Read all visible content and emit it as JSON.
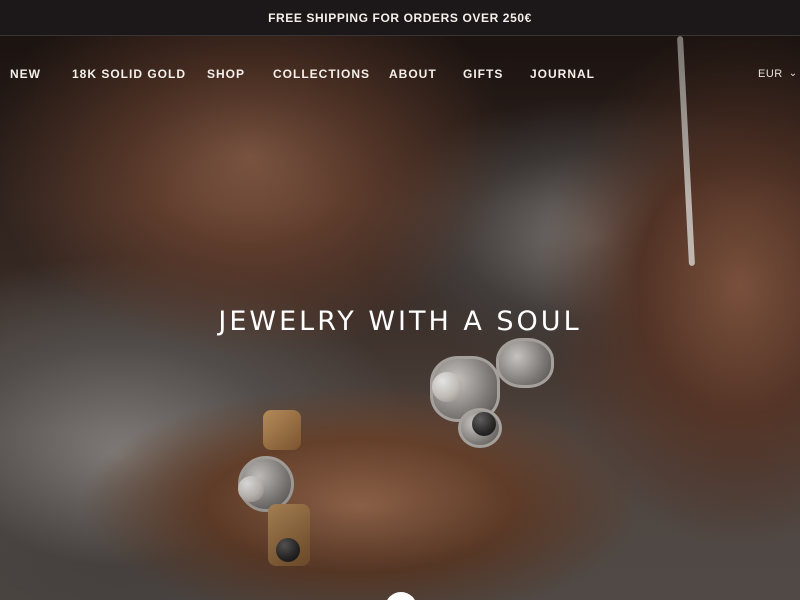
{
  "announcement": {
    "text": "FREE SHIPPING FOR ORDERS OVER 250€"
  },
  "nav": {
    "items": [
      {
        "label": "NEW"
      },
      {
        "label": "18K SOLID GOLD"
      },
      {
        "label": "SHOP"
      },
      {
        "label": "COLLECTIONS"
      },
      {
        "label": "ABOUT"
      },
      {
        "label": "GIFTS"
      },
      {
        "label": "JOURNAL"
      }
    ],
    "currency": {
      "value": "EUR",
      "icon": "chevron-down-icon"
    }
  },
  "hero": {
    "headline": "JEWELRY WITH A SOUL",
    "colors": {
      "text": "#ffffff",
      "bar": "#1c1819"
    }
  }
}
